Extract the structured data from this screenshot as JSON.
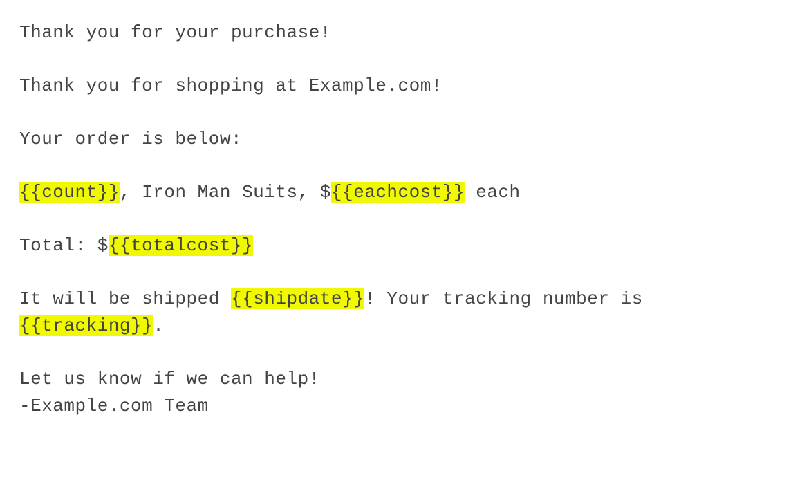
{
  "email": {
    "heading": "Thank you for your purchase!",
    "greeting": "Thank you for shopping at Example.com!",
    "order_intro": "Your order is below:",
    "line_item": {
      "count_placeholder": "{{count}}",
      "sep1": ", ",
      "product": "Iron Man Suits",
      "sep2": ", $",
      "eachcost_placeholder": "{{eachcost}}",
      "each_suffix": " each"
    },
    "total": {
      "prefix": "Total: $",
      "totalcost_placeholder": "{{totalcost}}"
    },
    "shipping": {
      "prefix": "It will be shipped ",
      "shipdate_placeholder": "{{shipdate}}",
      "mid": "! Your tracking number is ",
      "tracking_placeholder": "{{tracking}}",
      "suffix": "."
    },
    "closing1": "Let us know if we can help!",
    "closing2": "-Example.com Team"
  }
}
